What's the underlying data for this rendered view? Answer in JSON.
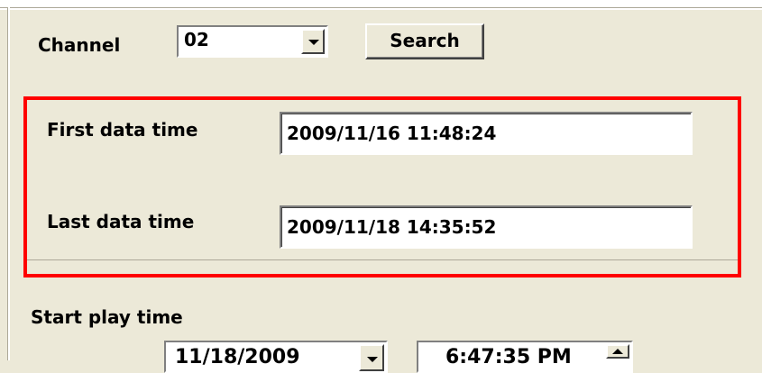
{
  "channel": {
    "label": "Channel",
    "value": "02",
    "search_label": "Search"
  },
  "data_range": {
    "first_label": "First data time",
    "first_value": "2009/11/16 11:48:24",
    "last_label": "Last data time",
    "last_value": "2009/11/18 14:35:52",
    "highlight_color": "#ff0000"
  },
  "playback": {
    "start_label": "Start play time",
    "date_value": "11/18/2009",
    "time_value": "6:47:35 PM"
  }
}
